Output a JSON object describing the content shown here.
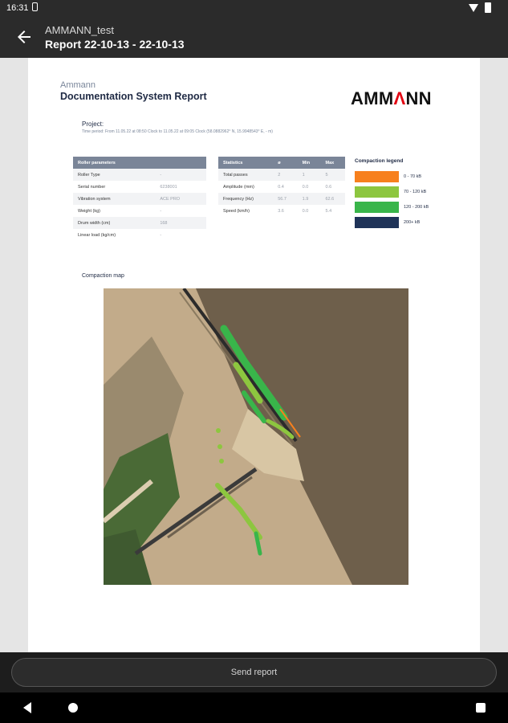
{
  "status": {
    "time": "16:31"
  },
  "appbar": {
    "subtitle": "AMMANN_test",
    "title": "Report 22-10-13 - 22-10-13"
  },
  "report": {
    "company": "Ammann",
    "title": "Documentation System Report",
    "logo_prefix": "AMM",
    "logo_accent": "Λ",
    "logo_suffix": "NN",
    "project_label": "Project:",
    "project_period": "Time period: From 11.05.22 at 08:50 Clock to 11.05.22 at 09:05 Clock (58.0882962° N, 15.9948543° E, - m)",
    "roller": {
      "header": "Roller parameters",
      "rows": [
        {
          "label": "Roller Type",
          "value": "-"
        },
        {
          "label": "Serial number",
          "value": "6238001"
        },
        {
          "label": "Vibration system",
          "value": "ACE PRO"
        },
        {
          "label": "Weight (kg)",
          "value": "-"
        },
        {
          "label": "Drum width (cm)",
          "value": "168"
        },
        {
          "label": "Linear load (kg/cm)",
          "value": "-"
        }
      ]
    },
    "stats": {
      "headers": [
        "Statistics",
        "ø",
        "Min",
        "Max"
      ],
      "rows": [
        {
          "label": "Total passes",
          "avg": "2",
          "min": "1",
          "max": "5"
        },
        {
          "label": "Amplitude (mm)",
          "avg": "0.4",
          "min": "0.0",
          "max": "0.6"
        },
        {
          "label": "Frequency (Hz)",
          "avg": "56.7",
          "min": "1.9",
          "max": "62.6"
        },
        {
          "label": "Speed (km/h)",
          "avg": "3.6",
          "min": "0.0",
          "max": "5.4"
        }
      ]
    },
    "legend": {
      "title": "Compaction legend",
      "items": [
        {
          "label": "0 - 70 kB",
          "color": "#f7801e"
        },
        {
          "label": "70 - 120 kB",
          "color": "#8dc63f"
        },
        {
          "label": "120 - 200 kB",
          "color": "#39b54a"
        },
        {
          "label": "200+ kB",
          "color": "#1f3358"
        }
      ]
    },
    "map_label": "Compaction map"
  },
  "footer": {
    "send_label": "Send report"
  }
}
